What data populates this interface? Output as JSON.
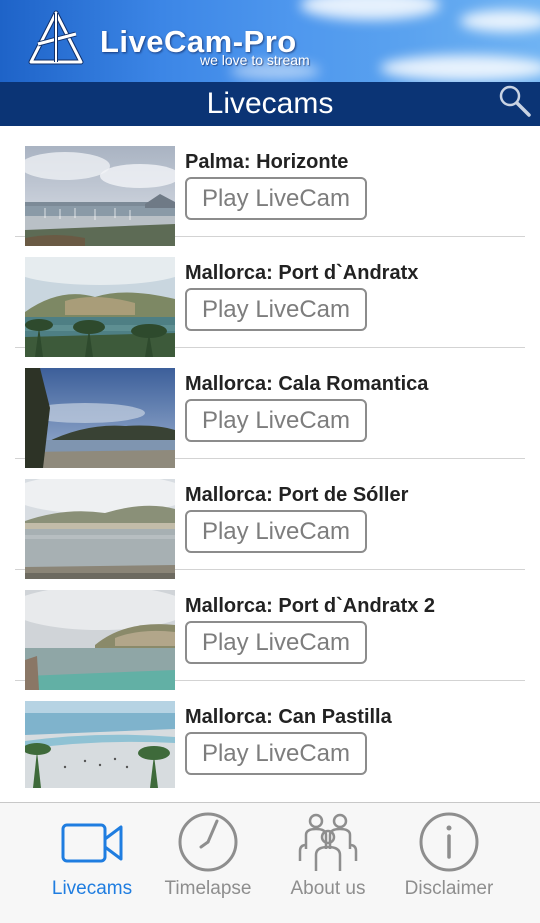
{
  "banner": {
    "brand_name": "LiveCam-Pro",
    "slogan": "we love to stream",
    "logo_icon": "livecam-pro-logo-icon"
  },
  "header": {
    "title": "Livecams",
    "search_icon": "search-icon"
  },
  "livecams": [
    {
      "title": "Palma: Horizonte",
      "button_label": "Play LiveCam"
    },
    {
      "title": "Mallorca: Port d`Andratx",
      "button_label": "Play LiveCam"
    },
    {
      "title": "Mallorca: Cala Romantica",
      "button_label": "Play LiveCam"
    },
    {
      "title": "Mallorca: Port de Sóller",
      "button_label": "Play LiveCam"
    },
    {
      "title": "Mallorca: Port d`Andratx 2",
      "button_label": "Play LiveCam"
    },
    {
      "title": "Mallorca: Can Pastilla",
      "button_label": "Play LiveCam"
    }
  ],
  "tabs": [
    {
      "label": "Livecams",
      "icon": "video-camera-icon",
      "active": true
    },
    {
      "label": "Timelapse",
      "icon": "clock-icon",
      "active": false
    },
    {
      "label": "About us",
      "icon": "people-icon",
      "active": false
    },
    {
      "label": "Disclaimer",
      "icon": "info-icon",
      "active": false
    }
  ],
  "colors": {
    "title_bar": "#0b3475",
    "active_tab": "#1f7de0",
    "inactive_tab": "#8e8e8e",
    "button_border": "#8c8c8c"
  }
}
